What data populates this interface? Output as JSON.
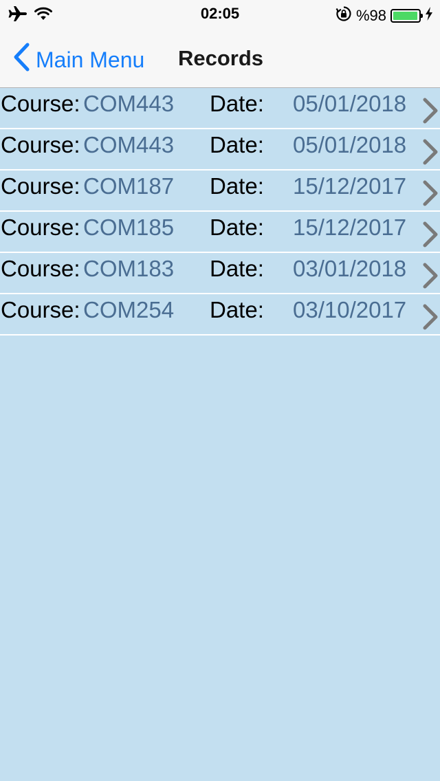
{
  "status_bar": {
    "time": "02:05",
    "battery_text": "%98",
    "battery_level": 0.98,
    "icons": [
      "airplane-icon",
      "wifi-icon",
      "rotation-lock-icon",
      "battery-icon",
      "charging-bolt-icon"
    ]
  },
  "nav": {
    "back_label": "Main Menu",
    "title": "Records",
    "back_icon": "chevron-left-icon"
  },
  "records": [
    {
      "course_label": "Course:",
      "course": "COM443",
      "date_label": "Date:",
      "date": "05/01/2018"
    },
    {
      "course_label": "Course:",
      "course": "COM443",
      "date_label": "Date:",
      "date": "05/01/2018"
    },
    {
      "course_label": "Course:",
      "course": "COM187",
      "date_label": "Date:",
      "date": "15/12/2017"
    },
    {
      "course_label": "Course:",
      "course": "COM185",
      "date_label": "Date:",
      "date": "15/12/2017"
    },
    {
      "course_label": "Course:",
      "course": "COM183",
      "date_label": "Date:",
      "date": "03/01/2018"
    },
    {
      "course_label": "Course:",
      "course": "COM254",
      "date_label": "Date:",
      "date": "03/10/2017"
    }
  ],
  "colors": {
    "background": "#c3dff0",
    "nav_background": "#f7f7f7",
    "accent": "#157efb",
    "value_text": "#4a6d92",
    "chevron": "#7a7a7a",
    "battery_fill": "#4cd964"
  }
}
